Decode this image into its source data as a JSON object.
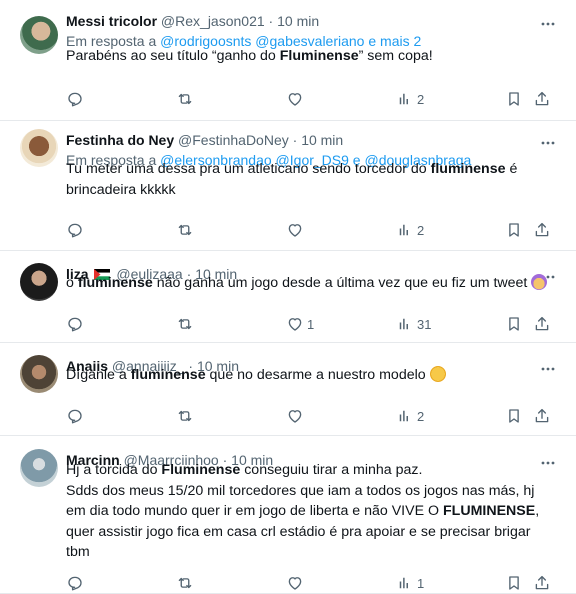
{
  "tweets": [
    {
      "name": "Messi tricolor",
      "handle": "@Rex_jason021",
      "separator": "·",
      "time": "10 min",
      "reply_prefix": "Em resposta a ",
      "reply_mentions": "@rodrigoosnts @gabesvaleriano e mais 2",
      "text_parts": [
        "Parabéns ao seu título “ganho do ",
        "Fluminense",
        "” sem copa!"
      ],
      "views": "2",
      "likes": ""
    },
    {
      "name": "Festinha do Ney",
      "handle": "@FestinhaDoNey",
      "separator": "·",
      "time": "10 min",
      "reply_prefix": "Em resposta a ",
      "reply_mentions": "@elersonbrandao @Igor_DS9 e @douglasnbraga",
      "text_parts": [
        "Tu meter uma dessa pra um atleticano sendo torcedor do ",
        "fluminense",
        " é brincadeira kkkkk"
      ],
      "views": "2",
      "likes": ""
    },
    {
      "name": "liza",
      "handle": "@eulizaaa",
      "separator": "·",
      "time": "10 min",
      "text_parts": [
        "o ",
        "fluminense",
        " não ganha um jogo desde a última vez que eu fiz um tweet "
      ],
      "views": "31",
      "likes": "1",
      "emoji": "woman-facepalming-emoji"
    },
    {
      "name": "Anaiis",
      "handle": "@annaiiiiz_",
      "separator": "·",
      "time": "10 min",
      "text_parts": [
        "Díganle a ",
        "fluminense",
        " que no desarme a nuestro modelo "
      ],
      "views": "2",
      "likes": "",
      "emoji": "disappointed-face-emoji"
    },
    {
      "name": "Marcinn",
      "handle": "@Maarrciinhoo",
      "separator": "·",
      "time": "10 min",
      "lines": [
        [
          "Hj a torcida do ",
          "Fluminense",
          " conseguiu tirar a minha paz."
        ],
        [
          "Sdds dos meus 15/20 mil torcedores que iam a todos os jogos nas más, hj"
        ],
        [
          "em dia todo mundo quer ir em jogo de liberta e não VIVE O ",
          "FLUMINENSE",
          ","
        ],
        [
          "quer assistir jogo fica em casa crl estádio é pra apoiar e se precisar brigar"
        ],
        [
          "tbm"
        ]
      ],
      "views": "1",
      "likes": ""
    }
  ],
  "colors": {
    "text": "#0f1419",
    "muted": "#536471",
    "link": "#1d9bf0",
    "divider": "#e6e9ec"
  },
  "icons": [
    "reply-icon",
    "retweet-icon",
    "like-icon",
    "views-icon",
    "bookmark-icon",
    "share-icon",
    "more-icon"
  ]
}
